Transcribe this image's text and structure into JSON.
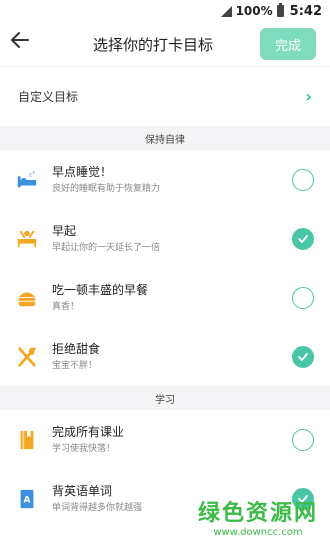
{
  "status": {
    "battery": "100%",
    "time": "5:42"
  },
  "nav": {
    "title": "选择你的打卡目标",
    "done_label": "完成"
  },
  "custom": {
    "label": "自定义目标",
    "chevron": "›"
  },
  "sections": [
    {
      "title": "保持自律",
      "items": [
        {
          "title": "早点睡觉！",
          "subtitle": "良好的睡眠有助于恢复精力",
          "checked": false,
          "icon": "bed-icon"
        },
        {
          "title": "早起",
          "subtitle": "早起让你的一天延长了一倍",
          "checked": true,
          "icon": "wake-up-icon"
        },
        {
          "title": "吃一顿丰盛的早餐",
          "subtitle": "真香！",
          "checked": false,
          "icon": "burger-icon"
        },
        {
          "title": "拒绝甜食",
          "subtitle": "宝宝不胖！",
          "checked": true,
          "icon": "utensils-icon"
        }
      ]
    },
    {
      "title": "学习",
      "items": [
        {
          "title": "完成所有课业",
          "subtitle": "学习使我快落！",
          "checked": false,
          "icon": "book-icon"
        },
        {
          "title": "背英语单词",
          "subtitle": "单词背得越多你就越强",
          "checked": true,
          "icon": "vocabulary-icon"
        }
      ]
    }
  ],
  "watermark": {
    "text": "绿色资源网",
    "url": "www.downcc.com"
  },
  "colors": {
    "accent": "#49c6a6",
    "icon_orange": "#f5a623",
    "icon_blue": "#3d8fe0",
    "watermark_green": "#3dbb48"
  }
}
